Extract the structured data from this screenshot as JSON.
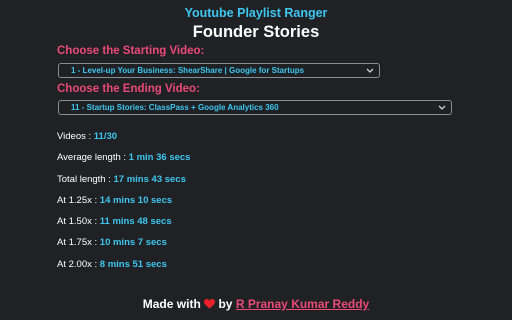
{
  "header": {
    "app_title": "Youtube Playlist Ranger",
    "playlist_title": "Founder Stories"
  },
  "start": {
    "label": "Choose the Starting Video:",
    "selected": "1 - Level-up Your Business: ShearShare | Google for Startups"
  },
  "end": {
    "label": "Choose the Ending Video:",
    "selected": "11 - Startup Stories: ClassPass + Google Analytics 360"
  },
  "stats": {
    "videos_label": "Videos : ",
    "videos_value": "11/30",
    "avg_label": "Average length : ",
    "avg_value": "1 min 36 secs",
    "total_label": "Total length : ",
    "total_value": "17 mins 43 secs",
    "s125_label": "At 1.25x : ",
    "s125_value": "14 mins 10 secs",
    "s150_label": "At 1.50x : ",
    "s150_value": "11 mins 48 secs",
    "s175_label": "At 1.75x : ",
    "s175_value": "10 mins 7 secs",
    "s200_label": "At 2.00x : ",
    "s200_value": "8 mins 51 secs"
  },
  "footer": {
    "made_with": "Made with",
    "by": "by",
    "author": "R Pranay Kumar Reddy",
    "heart_icon": "heart-icon",
    "heart_color": "#e8212b"
  },
  "colors": {
    "background": "#202124",
    "accent_blue": "#3ec6ef",
    "accent_pink": "#ea4a77"
  }
}
